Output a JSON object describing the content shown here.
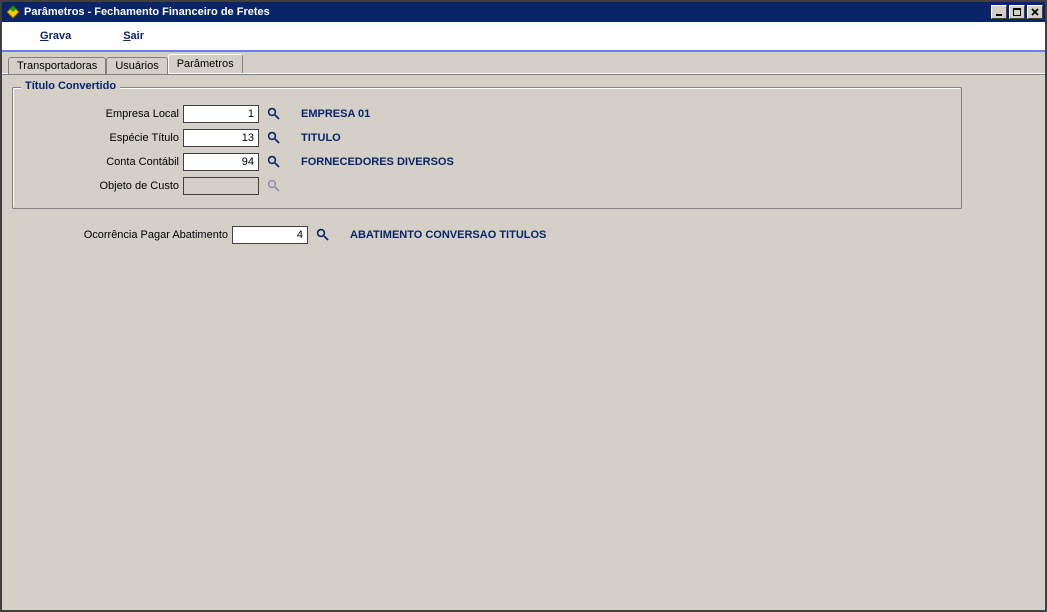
{
  "window": {
    "title": "Parâmetros - Fechamento Financeiro de Fretes"
  },
  "menu": {
    "grava_prefix": "G",
    "grava_rest": "rava",
    "sair_prefix": "S",
    "sair_rest": "air"
  },
  "tabs": {
    "transportadoras": "Transportadoras",
    "usuarios": "Usuários",
    "parametros": "Parâmetros"
  },
  "group": {
    "legend": "Título Convertido",
    "rows": {
      "empresa": {
        "label": "Empresa Local",
        "value": "1",
        "desc": "EMPRESA 01"
      },
      "especie": {
        "label": "Espécie Título",
        "value": "13",
        "desc": "TITULO"
      },
      "conta": {
        "label": "Conta Contábil",
        "value": "94",
        "desc": "FORNECEDORES DIVERSOS"
      },
      "objeto": {
        "label": "Objeto de Custo",
        "value": "",
        "desc": ""
      }
    }
  },
  "ocorrencia": {
    "label": "Ocorrência Pagar Abatimento",
    "value": "4",
    "desc": "ABATIMENTO CONVERSAO TITULOS"
  }
}
